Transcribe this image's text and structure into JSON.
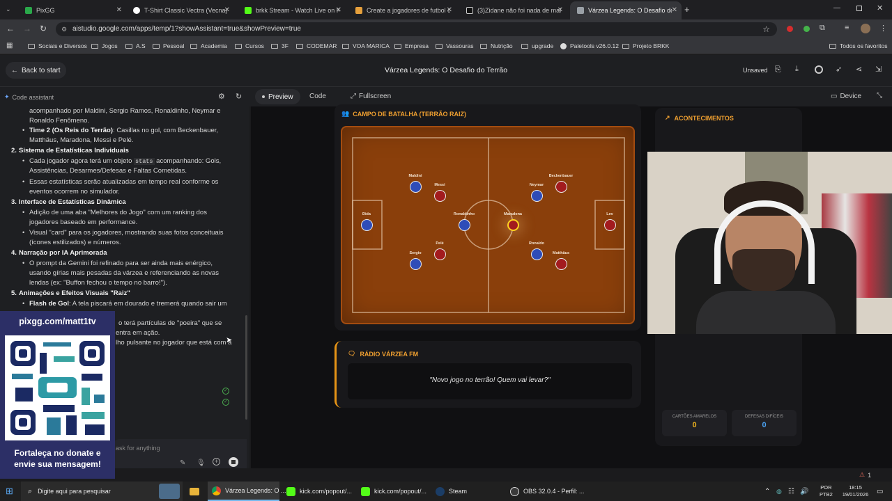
{
  "browser": {
    "tabs": [
      {
        "label": "PixGG",
        "color": "#2aa84a"
      },
      {
        "label": "T-Shirt Classic Vectra (Vecna) em",
        "color": "#ffffff"
      },
      {
        "label": "brkk Stream - Watch Live on Ki",
        "color": "#53fc18"
      },
      {
        "label": "Create a jogadores de futbol de",
        "color": "#e6a03c"
      },
      {
        "label": "(3)Zidane não foi nada de mais",
        "color": "#111111"
      },
      {
        "label": "Várzea Legends: O Desafio do T",
        "color": "#9aa0a6"
      }
    ],
    "url": "aistudio.google.com/apps/temp/1?showAssistant=true&showPreview=true",
    "bookmarks": [
      "Sociais e Diversos",
      "Jogos",
      "A.S",
      "Pessoal",
      "Academia",
      "Cursos",
      "3F",
      "CODEMAR",
      "VOA MARICA",
      "Empresa",
      "Vassouras",
      "Nutrição",
      "upgrade",
      "Paletools v26.0.12",
      "Projeto BRKK"
    ],
    "bookmarks_right": "Todos os favoritos"
  },
  "app": {
    "back_label": "Back to start",
    "title": "Várzea Legends: O Desafio do Terrão",
    "status": "Unsaved",
    "code_assistant": "Code assistant",
    "preview_tab": "Preview",
    "code_tab": "Code",
    "fullscreen": "Fullscreen",
    "device": "Device",
    "ask_placeholder": "ask for anything"
  },
  "assistant": {
    "lines": [
      "acompanhado por Maldini, Sergio Ramos, Ronaldinho, Neymar e",
      "Ronaldo Fenômeno.",
      "Casillas no gol, com Beckenbauer,",
      "Matthäus, Maradona, Messi e Pelé.",
      "Cada jogador agora terá um objeto",
      "acompanhando: Gols,",
      "Assistências, Desarmes/Defesas e Faltas Cometidas.",
      "Essas estatísticas serão atualizadas em tempo real conforme os",
      "eventos ocorrem no simulador.",
      "Adição de uma aba \"Melhores do Jogo\" com um ranking dos",
      "jogadores baseado em performance.",
      "Visual \"card\" para os jogadores, mostrando suas fotos conceituais",
      "(ícones estilizados) e números.",
      "O prompt da Gemini foi refinado para ser ainda mais enérgico,",
      "usando gírias mais pesadas da várzea e referenciando as novas",
      "lendas (ex: \"Buffon fechou o tempo no barro!\").",
      "A tela piscará em dourado e tremerá quando sair um",
      "o terá partículas de \"poeira\" que se",
      "entra em ação.",
      "lho pulsante no jogador que está com a"
    ],
    "time2_label": "Time 2 (Os Reis do Terrão)",
    "stats_code": "stats",
    "heading2": "Sistema de Estatísticas Individuais",
    "heading3": "Interface de Estatísticas Dinâmica",
    "heading4": "Narração por IA Aprimorada",
    "heading5": "Animações e Efeitos Visuais \"Raiz\"",
    "flash_label": "Flash de Gol",
    "n2": "2.",
    "n3": "3.",
    "n4": "4.",
    "n5": "5."
  },
  "game": {
    "pitch_title": "CAMPO DE BATALHA (TERRÃO RAIZ)",
    "events_title": "ACONTECIMENTOS",
    "radio_title": "RÁDIO VÁRZEA FM",
    "radio_text": "\"Novo jogo no terrão! Quem vai levar?\"",
    "yellow_cards_label": "CARTÕES AMARELOS",
    "yellow_cards_value": "0",
    "saves_label": "DEFESAS DIFÍCEIS",
    "saves_value": "0",
    "players": [
      {
        "name": "Dida",
        "team": "blue"
      },
      {
        "name": "Maldini",
        "team": "blue"
      },
      {
        "name": "Sergio",
        "team": "blue"
      },
      {
        "name": "Ronaldinho",
        "team": "blue"
      },
      {
        "name": "Neymar",
        "team": "blue"
      },
      {
        "name": "Ronaldo",
        "team": "blue"
      },
      {
        "name": "Messi",
        "team": "red"
      },
      {
        "name": "Pelé",
        "team": "red"
      },
      {
        "name": "Maradona",
        "team": "red",
        "has_ball": true
      },
      {
        "name": "Beckenbauer",
        "team": "red"
      },
      {
        "name": "Matthäus",
        "team": "red"
      },
      {
        "name": "Lev",
        "team": "red"
      }
    ]
  },
  "overlay": {
    "pix_url": "pixgg.com/matt1tv",
    "donate_text_1": "Fortaleça no donate e",
    "donate_text_2": "envie sua mensagem!"
  },
  "taskbar": {
    "search": "Digite aqui para pesquisar",
    "items": [
      "Várzea Legends: O ...",
      "kick.com/popout/...",
      "kick.com/popout/...",
      "Steam",
      "OBS 32.0.4 - Perfil: ..."
    ],
    "lang1": "POR",
    "lang2": "PTB2",
    "time": "18:15",
    "date": "19/01/2026",
    "warn_count": "1"
  }
}
